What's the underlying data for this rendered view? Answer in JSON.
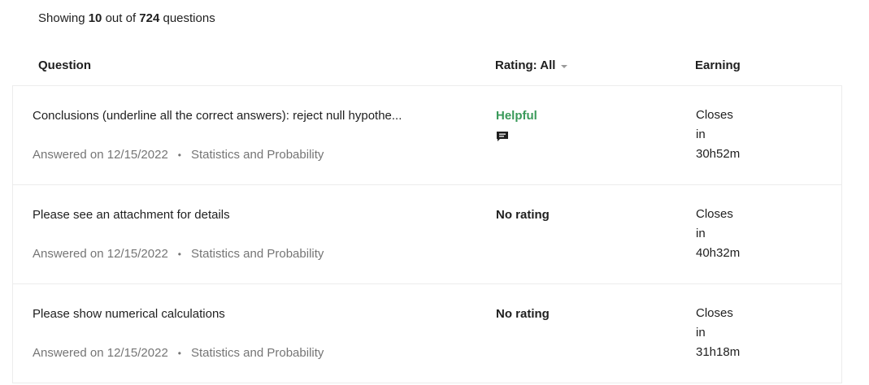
{
  "summary": {
    "prefix": "Showing",
    "shown": "10",
    "middle": "out of",
    "total": "724",
    "suffix": "questions"
  },
  "columns": {
    "question": "Question",
    "rating": "Rating: All",
    "earning": "Earning"
  },
  "rows": [
    {
      "title": "Conclusions (underline all the correct answers): reject null hypothe...",
      "answered": "Answered on 12/15/2022",
      "subject": "Statistics and Probability",
      "rating": "Helpful",
      "has_comment": true,
      "earning_line1": "Closes",
      "earning_line2": "in",
      "earning_line3": "30h52m"
    },
    {
      "title": "Please see an attachment for details",
      "answered": "Answered on 12/15/2022",
      "subject": "Statistics and Probability",
      "rating": "No rating",
      "has_comment": false,
      "earning_line1": "Closes",
      "earning_line2": "in",
      "earning_line3": "40h32m"
    },
    {
      "title": "Please show numerical calculations",
      "answered": "Answered on 12/15/2022",
      "subject": "Statistics and Probability",
      "rating": "No rating",
      "has_comment": false,
      "earning_line1": "Closes",
      "earning_line2": "in",
      "earning_line3": "31h18m"
    }
  ],
  "colors": {
    "helpful": "#3a9a5a",
    "meta_text": "#757575",
    "primary_text": "#1f1f1f",
    "row_border": "#ececec"
  },
  "icons": {
    "comment": "comment-icon",
    "rating_dropdown": "chevron-down-icon"
  }
}
